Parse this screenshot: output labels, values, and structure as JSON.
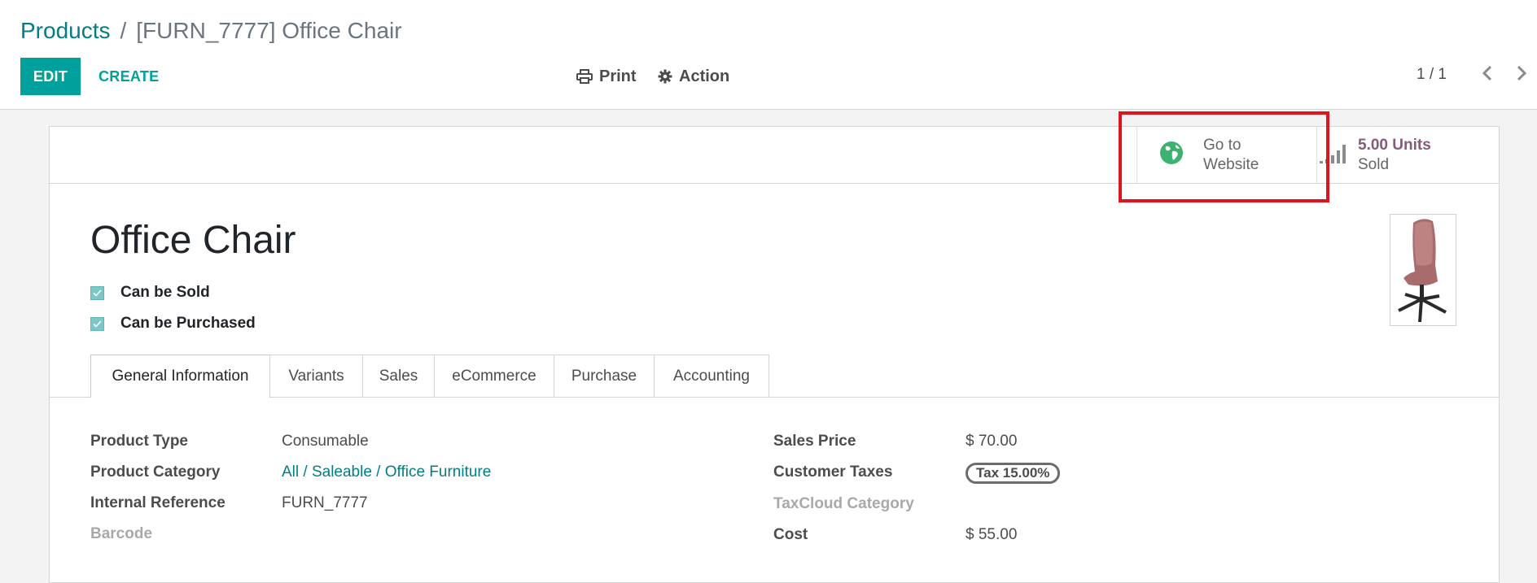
{
  "breadcrumb": {
    "parent": "Products",
    "separator": "/",
    "current": "[FURN_7777] Office Chair"
  },
  "toolbar": {
    "edit_label": "EDIT",
    "create_label": "CREATE",
    "print_label": "Print",
    "action_label": "Action"
  },
  "pager": {
    "value": "1 / 1"
  },
  "smart_buttons": {
    "website": {
      "line1": "Go to",
      "line2": "Website",
      "icon": "globe-icon"
    },
    "sold": {
      "value": "5.00 Units",
      "label": "Sold",
      "icon": "signal-bars-icon"
    }
  },
  "product": {
    "name": "Office Chair",
    "can_be_sold_label": "Can be Sold",
    "can_be_sold": true,
    "can_be_purchased_label": "Can be Purchased",
    "can_be_purchased": true
  },
  "tabs": [
    {
      "label": "General Information",
      "active": true
    },
    {
      "label": "Variants"
    },
    {
      "label": "Sales"
    },
    {
      "label": "eCommerce"
    },
    {
      "label": "Purchase"
    },
    {
      "label": "Accounting"
    }
  ],
  "general_info": {
    "left": [
      {
        "label": "Product Type",
        "value": "Consumable"
      },
      {
        "label": "Product Category",
        "value": "All / Saleable / Office Furniture"
      },
      {
        "label": "Internal Reference",
        "value": "FURN_7777"
      },
      {
        "label": "Barcode",
        "value": ""
      }
    ],
    "right": [
      {
        "label": "Sales Price",
        "value": "$ 70.00"
      },
      {
        "label": "Customer Taxes",
        "value": "Tax 15.00%"
      },
      {
        "label": "TaxCloud Category",
        "value": ""
      },
      {
        "label": "Cost",
        "value": "$ 55.00"
      }
    ]
  },
  "colors": {
    "accent": "#00a09d",
    "link": "#017e84",
    "stat_value": "#875a7b",
    "highlight": "#e0141e"
  }
}
